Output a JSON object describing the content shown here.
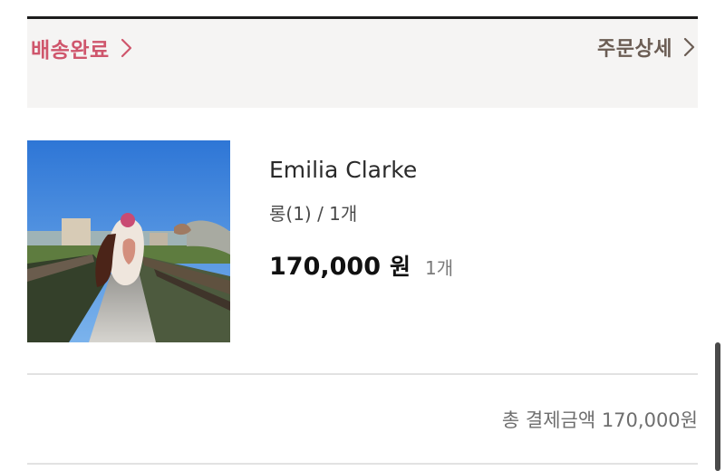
{
  "order": {
    "status_label": "배송완료",
    "detail_label": "주문상세"
  },
  "product": {
    "title": "Emilia Clarke",
    "option": "롱(1) / 1개",
    "price": "170,000",
    "price_unit": "원",
    "quantity": "1개"
  },
  "summary": {
    "total_text": "총 결제금액 170,000원"
  },
  "colors": {
    "status_accent": "#cf566c",
    "detail_text": "#6b5d54",
    "header_bg": "#f5f4f3"
  },
  "icons": {
    "status_chevron": "chevron-right-icon",
    "detail_chevron": "chevron-right-icon"
  }
}
